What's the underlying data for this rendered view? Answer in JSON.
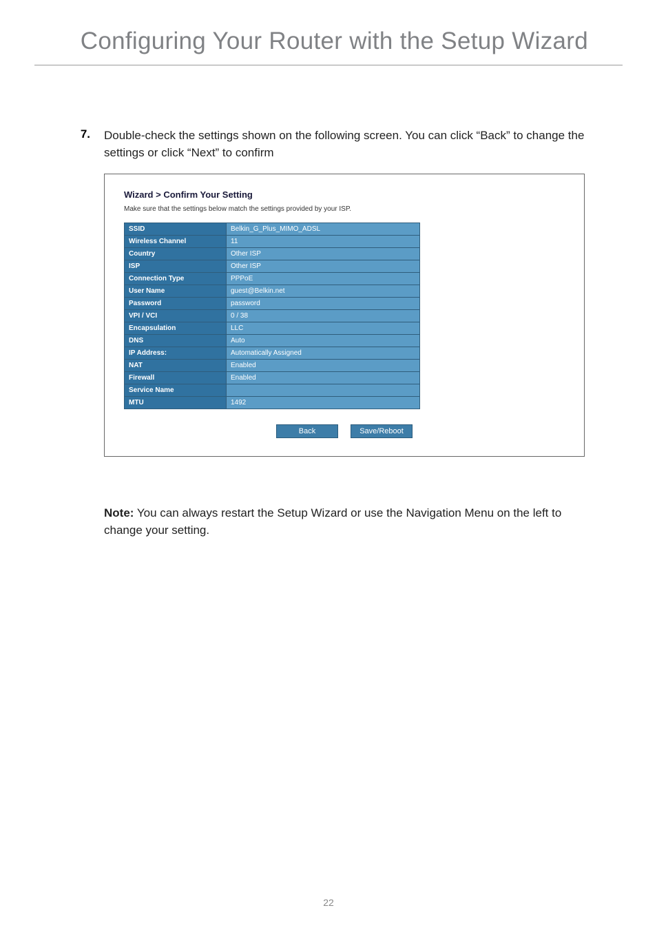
{
  "header": {
    "title": "Configuring Your Router with the Setup Wizard"
  },
  "step": {
    "number": "7.",
    "text": "Double-check the settings shown on the following screen. You can click “Back” to change the settings or click “Next” to confirm"
  },
  "wizard": {
    "title": "Wizard > Confirm Your Setting",
    "subtitle": "Make sure that the settings below match the settings provided by your ISP.",
    "rows": [
      {
        "label": "SSID",
        "value": "Belkin_G_Plus_MIMO_ADSL"
      },
      {
        "label": "Wireless Channel",
        "value": "11"
      },
      {
        "label": "Country",
        "value": "Other ISP"
      },
      {
        "label": "ISP",
        "value": "Other ISP"
      },
      {
        "label": "Connection Type",
        "value": "PPPoE"
      },
      {
        "label": "User Name",
        "value": "guest@Belkin.net"
      },
      {
        "label": "Password",
        "value": "password"
      },
      {
        "label": "VPI / VCI",
        "value": "0 / 38"
      },
      {
        "label": "Encapsulation",
        "value": "LLC"
      },
      {
        "label": "DNS",
        "value": "Auto"
      },
      {
        "label": "IP Address:",
        "value": "Automatically Assigned"
      },
      {
        "label": "NAT",
        "value": "Enabled"
      },
      {
        "label": "Firewall",
        "value": "Enabled"
      },
      {
        "label": "Service Name",
        "value": ""
      },
      {
        "label": "MTU",
        "value": "1492"
      }
    ],
    "buttons": {
      "back": "Back",
      "save": "Save/Reboot"
    }
  },
  "note": {
    "label": "Note:",
    "text": " You can always restart the Setup Wizard or use the Navigation Menu on the left to change your setting."
  },
  "page_number": "22"
}
